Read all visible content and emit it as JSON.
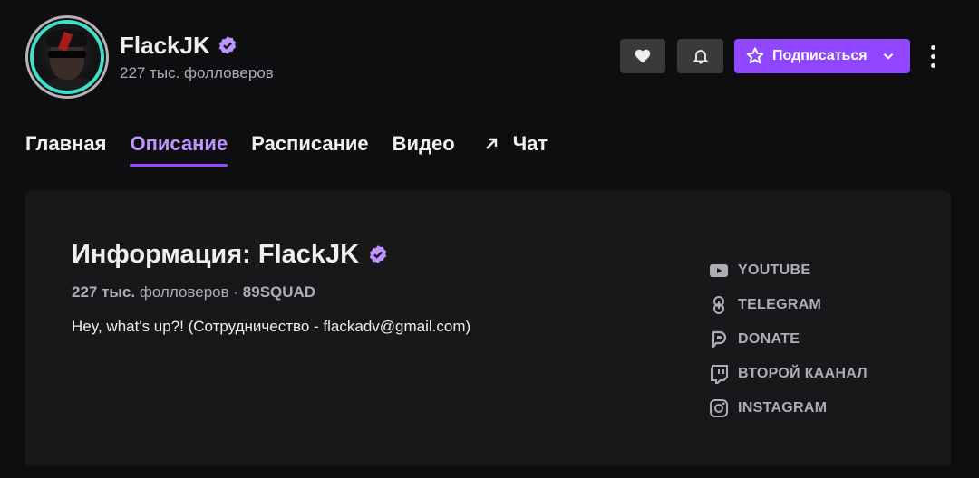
{
  "channel": {
    "name": "FlackJK",
    "followers_label": "227 тыс. фолловеров"
  },
  "actions": {
    "follow_icon": "heart-icon",
    "notify_icon": "bell-icon",
    "subscribe_label": "Подписаться",
    "more_icon": "more-vertical-icon"
  },
  "tabs": [
    {
      "label": "Главная",
      "active": false
    },
    {
      "label": "Описание",
      "active": true
    },
    {
      "label": "Расписание",
      "active": false
    },
    {
      "label": "Видео",
      "active": false
    },
    {
      "label": "Чат",
      "active": false,
      "icon": "external-arrow-icon"
    }
  ],
  "about": {
    "title": "Информация: FlackJK",
    "followers_count": "227 тыс.",
    "followers_word": "фолловеров",
    "separator": "·",
    "team": "89SQUAD",
    "bio": "Hey, what's up?! (Сотрудничество - flackadv@gmail.com)"
  },
  "links": [
    {
      "label": "YOUTUBE",
      "icon": "youtube-icon"
    },
    {
      "label": "TELEGRAM",
      "icon": "link-icon"
    },
    {
      "label": "DONATE",
      "icon": "donationalerts-icon"
    },
    {
      "label": "ВТОРОЙ КААНАЛ",
      "icon": "twitch-icon"
    },
    {
      "label": "INSTAGRAM",
      "icon": "instagram-icon"
    }
  ],
  "colors": {
    "background": "#0e0e10",
    "panel": "#18181b",
    "accent": "#9147ff",
    "accent_text": "#bf94ff",
    "muted_text": "#adadb8"
  }
}
